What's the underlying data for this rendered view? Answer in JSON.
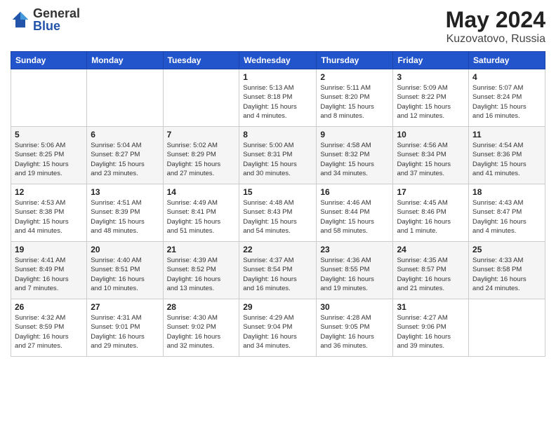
{
  "header": {
    "logo_general": "General",
    "logo_blue": "Blue",
    "title": "May 2024",
    "location": "Kuzovatovo, Russia"
  },
  "weekdays": [
    "Sunday",
    "Monday",
    "Tuesday",
    "Wednesday",
    "Thursday",
    "Friday",
    "Saturday"
  ],
  "weeks": [
    [
      {
        "day": "",
        "info": ""
      },
      {
        "day": "",
        "info": ""
      },
      {
        "day": "",
        "info": ""
      },
      {
        "day": "1",
        "info": "Sunrise: 5:13 AM\nSunset: 8:18 PM\nDaylight: 15 hours\nand 4 minutes."
      },
      {
        "day": "2",
        "info": "Sunrise: 5:11 AM\nSunset: 8:20 PM\nDaylight: 15 hours\nand 8 minutes."
      },
      {
        "day": "3",
        "info": "Sunrise: 5:09 AM\nSunset: 8:22 PM\nDaylight: 15 hours\nand 12 minutes."
      },
      {
        "day": "4",
        "info": "Sunrise: 5:07 AM\nSunset: 8:24 PM\nDaylight: 15 hours\nand 16 minutes."
      }
    ],
    [
      {
        "day": "5",
        "info": "Sunrise: 5:06 AM\nSunset: 8:25 PM\nDaylight: 15 hours\nand 19 minutes."
      },
      {
        "day": "6",
        "info": "Sunrise: 5:04 AM\nSunset: 8:27 PM\nDaylight: 15 hours\nand 23 minutes."
      },
      {
        "day": "7",
        "info": "Sunrise: 5:02 AM\nSunset: 8:29 PM\nDaylight: 15 hours\nand 27 minutes."
      },
      {
        "day": "8",
        "info": "Sunrise: 5:00 AM\nSunset: 8:31 PM\nDaylight: 15 hours\nand 30 minutes."
      },
      {
        "day": "9",
        "info": "Sunrise: 4:58 AM\nSunset: 8:32 PM\nDaylight: 15 hours\nand 34 minutes."
      },
      {
        "day": "10",
        "info": "Sunrise: 4:56 AM\nSunset: 8:34 PM\nDaylight: 15 hours\nand 37 minutes."
      },
      {
        "day": "11",
        "info": "Sunrise: 4:54 AM\nSunset: 8:36 PM\nDaylight: 15 hours\nand 41 minutes."
      }
    ],
    [
      {
        "day": "12",
        "info": "Sunrise: 4:53 AM\nSunset: 8:38 PM\nDaylight: 15 hours\nand 44 minutes."
      },
      {
        "day": "13",
        "info": "Sunrise: 4:51 AM\nSunset: 8:39 PM\nDaylight: 15 hours\nand 48 minutes."
      },
      {
        "day": "14",
        "info": "Sunrise: 4:49 AM\nSunset: 8:41 PM\nDaylight: 15 hours\nand 51 minutes."
      },
      {
        "day": "15",
        "info": "Sunrise: 4:48 AM\nSunset: 8:43 PM\nDaylight: 15 hours\nand 54 minutes."
      },
      {
        "day": "16",
        "info": "Sunrise: 4:46 AM\nSunset: 8:44 PM\nDaylight: 15 hours\nand 58 minutes."
      },
      {
        "day": "17",
        "info": "Sunrise: 4:45 AM\nSunset: 8:46 PM\nDaylight: 16 hours\nand 1 minute."
      },
      {
        "day": "18",
        "info": "Sunrise: 4:43 AM\nSunset: 8:47 PM\nDaylight: 16 hours\nand 4 minutes."
      }
    ],
    [
      {
        "day": "19",
        "info": "Sunrise: 4:41 AM\nSunset: 8:49 PM\nDaylight: 16 hours\nand 7 minutes."
      },
      {
        "day": "20",
        "info": "Sunrise: 4:40 AM\nSunset: 8:51 PM\nDaylight: 16 hours\nand 10 minutes."
      },
      {
        "day": "21",
        "info": "Sunrise: 4:39 AM\nSunset: 8:52 PM\nDaylight: 16 hours\nand 13 minutes."
      },
      {
        "day": "22",
        "info": "Sunrise: 4:37 AM\nSunset: 8:54 PM\nDaylight: 16 hours\nand 16 minutes."
      },
      {
        "day": "23",
        "info": "Sunrise: 4:36 AM\nSunset: 8:55 PM\nDaylight: 16 hours\nand 19 minutes."
      },
      {
        "day": "24",
        "info": "Sunrise: 4:35 AM\nSunset: 8:57 PM\nDaylight: 16 hours\nand 21 minutes."
      },
      {
        "day": "25",
        "info": "Sunrise: 4:33 AM\nSunset: 8:58 PM\nDaylight: 16 hours\nand 24 minutes."
      }
    ],
    [
      {
        "day": "26",
        "info": "Sunrise: 4:32 AM\nSunset: 8:59 PM\nDaylight: 16 hours\nand 27 minutes."
      },
      {
        "day": "27",
        "info": "Sunrise: 4:31 AM\nSunset: 9:01 PM\nDaylight: 16 hours\nand 29 minutes."
      },
      {
        "day": "28",
        "info": "Sunrise: 4:30 AM\nSunset: 9:02 PM\nDaylight: 16 hours\nand 32 minutes."
      },
      {
        "day": "29",
        "info": "Sunrise: 4:29 AM\nSunset: 9:04 PM\nDaylight: 16 hours\nand 34 minutes."
      },
      {
        "day": "30",
        "info": "Sunrise: 4:28 AM\nSunset: 9:05 PM\nDaylight: 16 hours\nand 36 minutes."
      },
      {
        "day": "31",
        "info": "Sunrise: 4:27 AM\nSunset: 9:06 PM\nDaylight: 16 hours\nand 39 minutes."
      },
      {
        "day": "",
        "info": ""
      }
    ]
  ]
}
